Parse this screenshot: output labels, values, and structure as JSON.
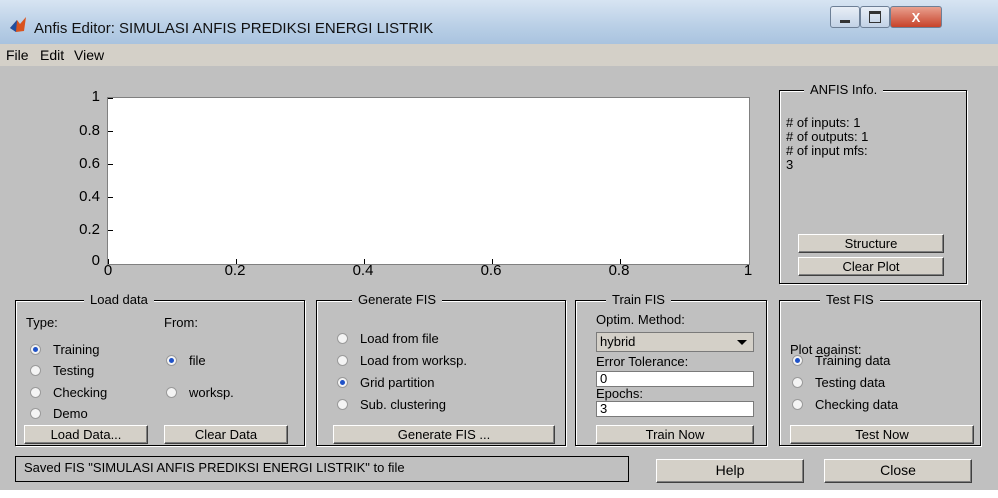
{
  "window": {
    "title": "Anfis Editor: SIMULASI ANFIS PREDIKSI ENERGI LISTRIK",
    "close_glyph": "X"
  },
  "menu": {
    "items": [
      "File",
      "Edit",
      "View"
    ]
  },
  "plot": {
    "y_ticks": [
      "1",
      "0.8",
      "0.6",
      "0.4",
      "0.2",
      "0"
    ],
    "x_ticks": [
      "0",
      "0.2",
      "0.4",
      "0.6",
      "0.8",
      "1"
    ]
  },
  "anfis_info": {
    "title": "ANFIS Info.",
    "inputs": "# of inputs: 1",
    "outputs": "# of outputs: 1",
    "input_mfs": "# of input mfs:",
    "input_mfs_value": "3",
    "structure_button": "Structure",
    "clear_plot_button": "Clear Plot"
  },
  "load_data": {
    "title": "Load data",
    "type_label": "Type:",
    "from_label": "From:",
    "types": [
      "Training",
      "Testing",
      "Checking",
      "Demo"
    ],
    "selected_type": "Training",
    "sources": [
      "file",
      "worksp."
    ],
    "selected_source": "file",
    "load_button": "Load Data...",
    "clear_button": "Clear Data"
  },
  "generate_fis": {
    "title": "Generate FIS",
    "options": [
      "Load from file",
      "Load from worksp.",
      "Grid partition",
      "Sub. clustering"
    ],
    "selected": "Grid partition",
    "button": "Generate FIS ..."
  },
  "train_fis": {
    "title": "Train FIS",
    "method_label": "Optim. Method:",
    "method_value": "hybrid",
    "tolerance_label": "Error Tolerance:",
    "tolerance_value": "0",
    "epochs_label": "Epochs:",
    "epochs_value": "3",
    "button": "Train Now"
  },
  "test_fis": {
    "title": "Test FIS",
    "plot_against_label": "Plot against:",
    "options": [
      "Training data",
      "Testing data",
      "Checking data"
    ],
    "selected": "Training data",
    "button": "Test Now"
  },
  "status": {
    "message": "Saved FIS \"SIMULASI ANFIS PREDIKSI ENERGI LISTRIK\" to file",
    "help_button": "Help",
    "close_button": "Close"
  }
}
